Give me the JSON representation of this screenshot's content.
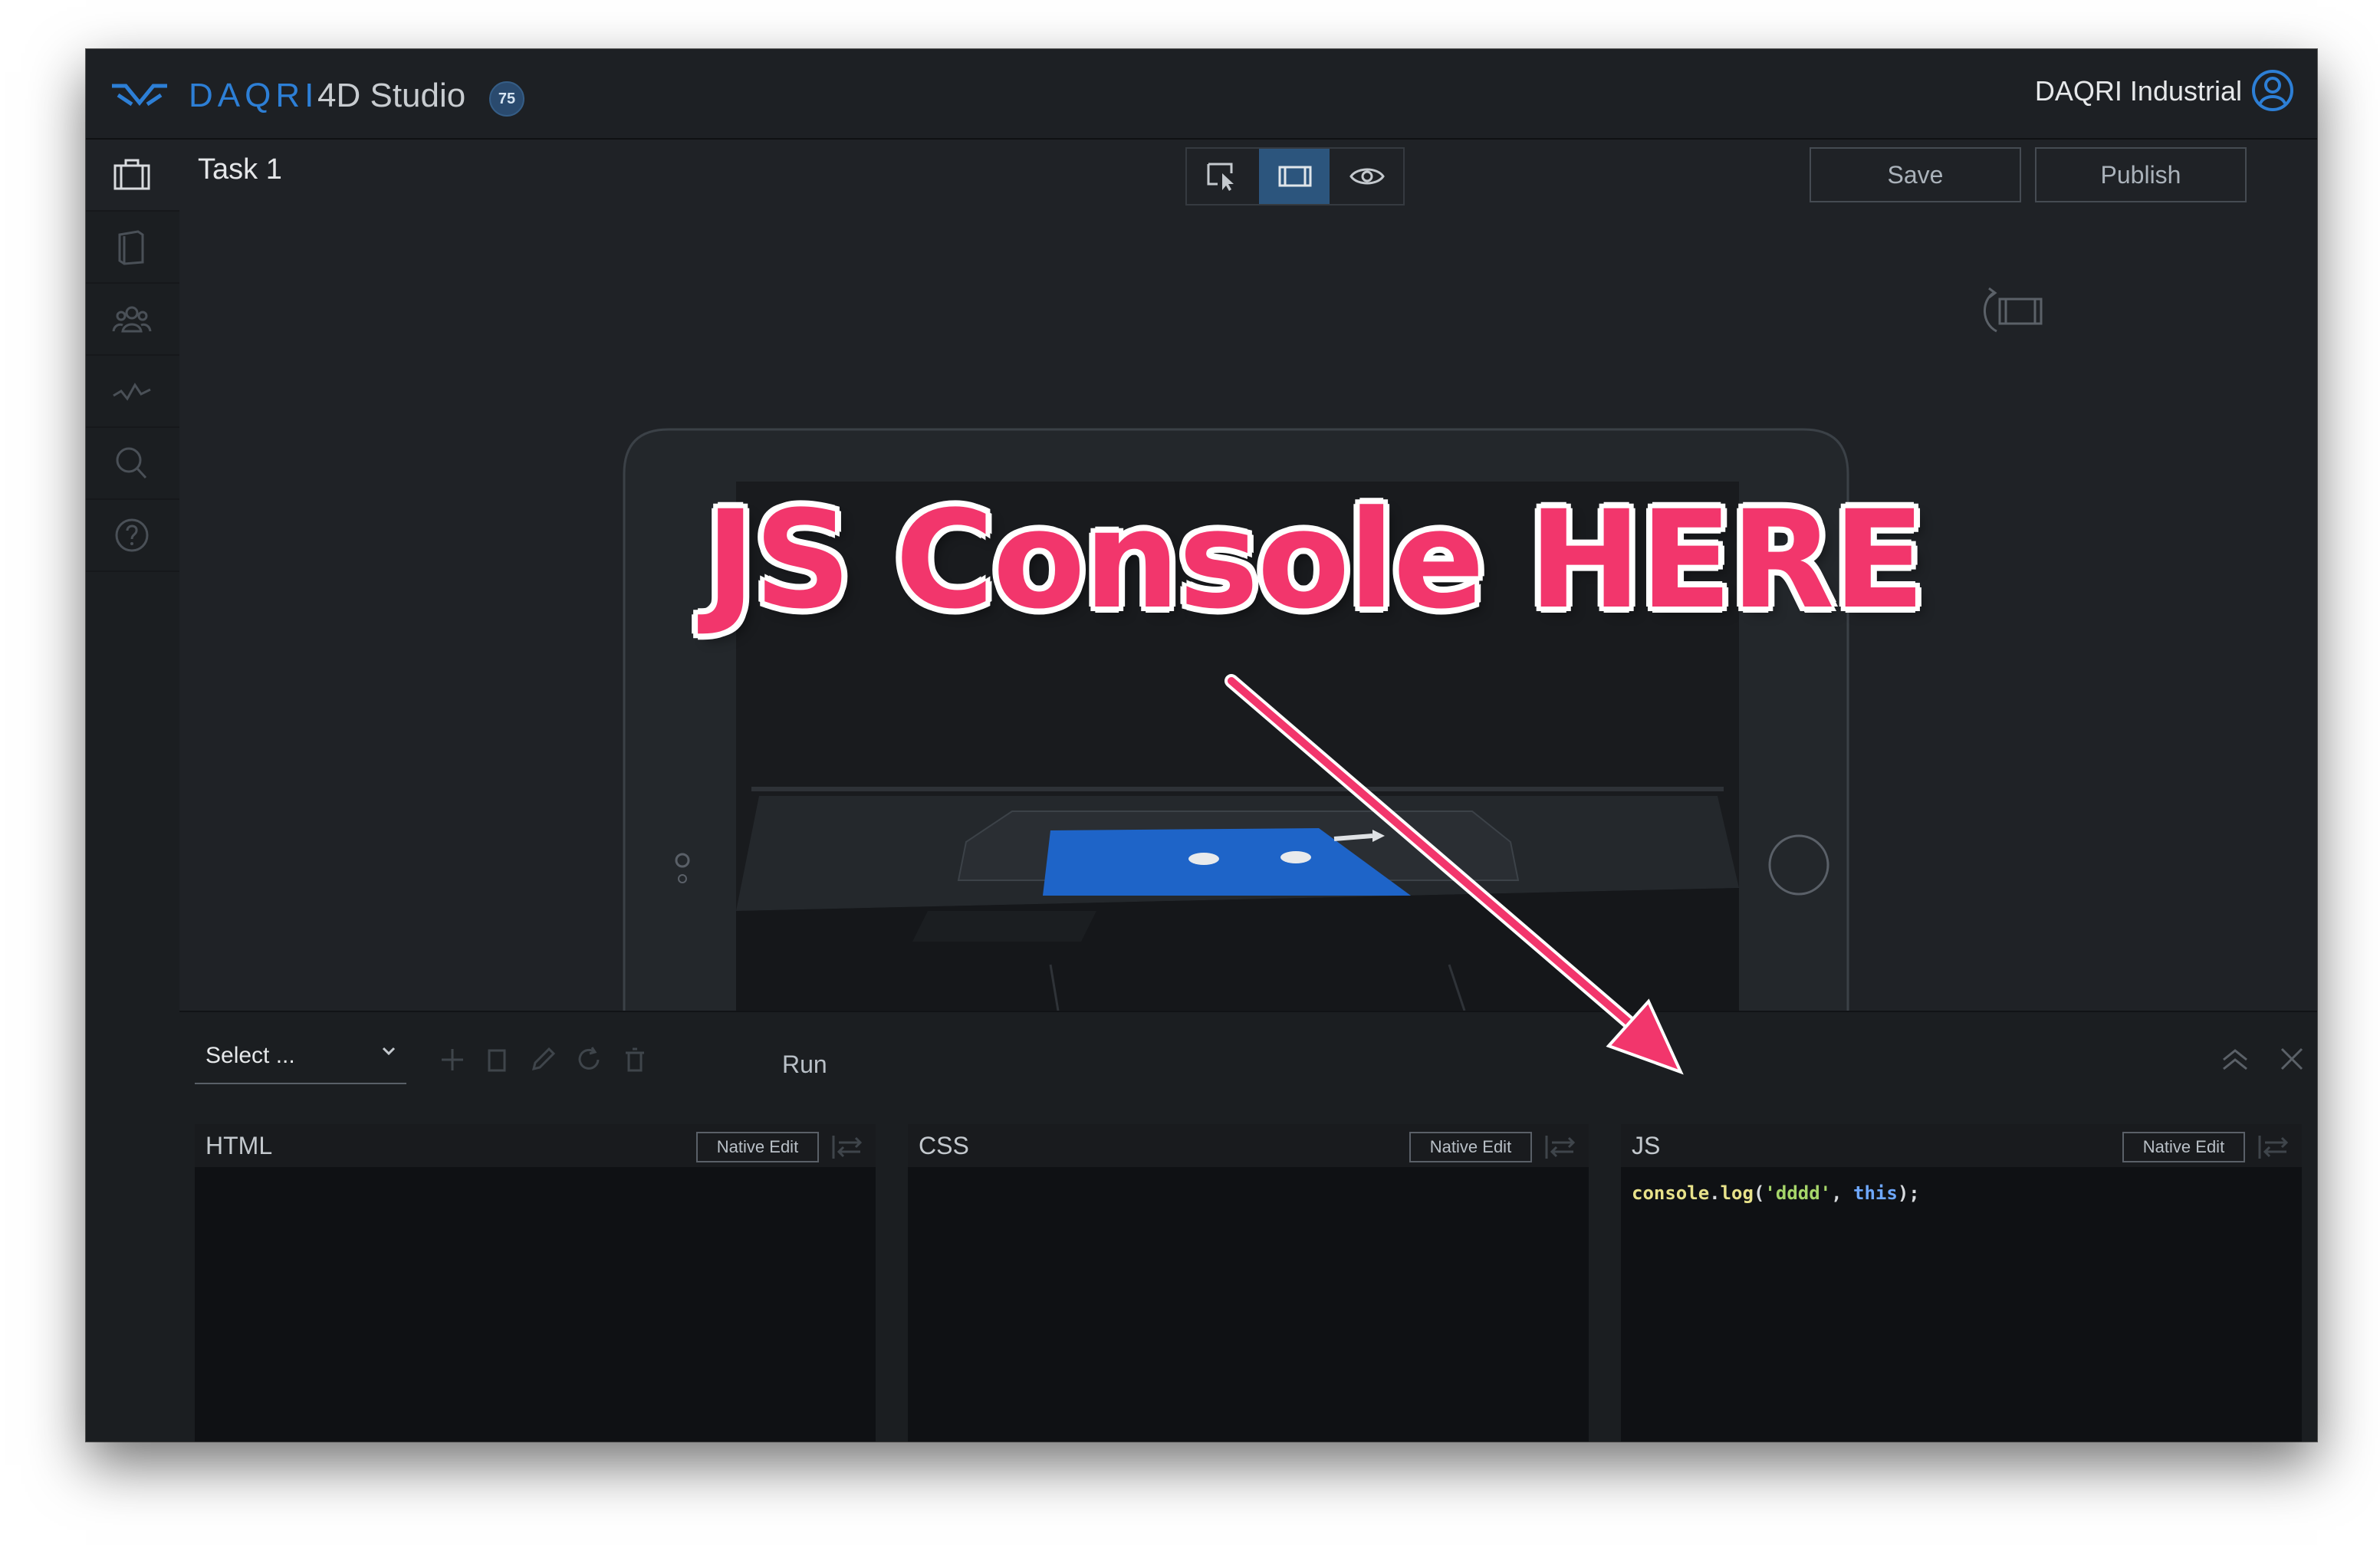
{
  "app": {
    "brand_primary": "DAQRI",
    "brand_secondary": "4D Studio",
    "version_badge": "75",
    "organization": "DAQRI Industrial",
    "colors": {
      "accent": "#2d7fd6",
      "annotation": "#f2366c",
      "active_mode": "#2c557d"
    }
  },
  "sidebar": {
    "items": [
      {
        "icon": "briefcase-icon"
      },
      {
        "icon": "book-icon"
      },
      {
        "icon": "users-icon"
      },
      {
        "icon": "analytics-icon"
      },
      {
        "icon": "search-icon"
      },
      {
        "icon": "help-icon"
      }
    ]
  },
  "header": {
    "task_title": "Task 1",
    "modes": [
      {
        "icon": "select-cursor-icon",
        "active": false
      },
      {
        "icon": "tablet-view-icon",
        "active": true
      },
      {
        "icon": "preview-eye-icon",
        "active": false
      }
    ],
    "save_label": "Save",
    "publish_label": "Publish"
  },
  "annotation": {
    "text": "JS Console HERE"
  },
  "editor": {
    "select_label": "Select ...",
    "run_label": "Run",
    "panes": [
      {
        "title": "HTML",
        "native_edit": "Native Edit",
        "code": ""
      },
      {
        "title": "CSS",
        "native_edit": "Native Edit",
        "code": ""
      },
      {
        "title": "JS",
        "native_edit": "Native Edit",
        "code_parts": {
          "obj": "console",
          "dot": ".",
          "method": "log",
          "open": "(",
          "str": "'dddd'",
          "comma": ", ",
          "kw": "this",
          "close": ");"
        }
      }
    ]
  }
}
